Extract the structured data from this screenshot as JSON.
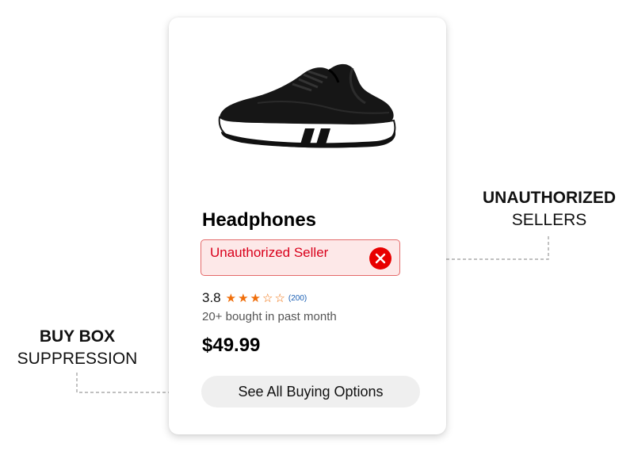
{
  "product": {
    "image_alt": "black knit sneaker with white sole",
    "title": "Headphones",
    "seller_badge": {
      "text": "Unauthorized Seller",
      "icon": "close-circle-icon",
      "color": "#e80000"
    },
    "rating": {
      "value": "3.8",
      "stars_filled": 3,
      "stars_total": 5,
      "review_count": "(200)"
    },
    "bought_text": "20+ bought in past month",
    "price": "$49.99",
    "options_button_label": "See All Buying Options"
  },
  "annotations": {
    "right": {
      "line1": "UNAUTHORIZED",
      "line2": "SELLERS"
    },
    "left": {
      "line1": "BUY BOX",
      "line2": "SUPPRESSION"
    }
  },
  "colors": {
    "star": "#f06e0a",
    "badge_bg": "#fde8e8",
    "badge_text": "#d9001b"
  }
}
